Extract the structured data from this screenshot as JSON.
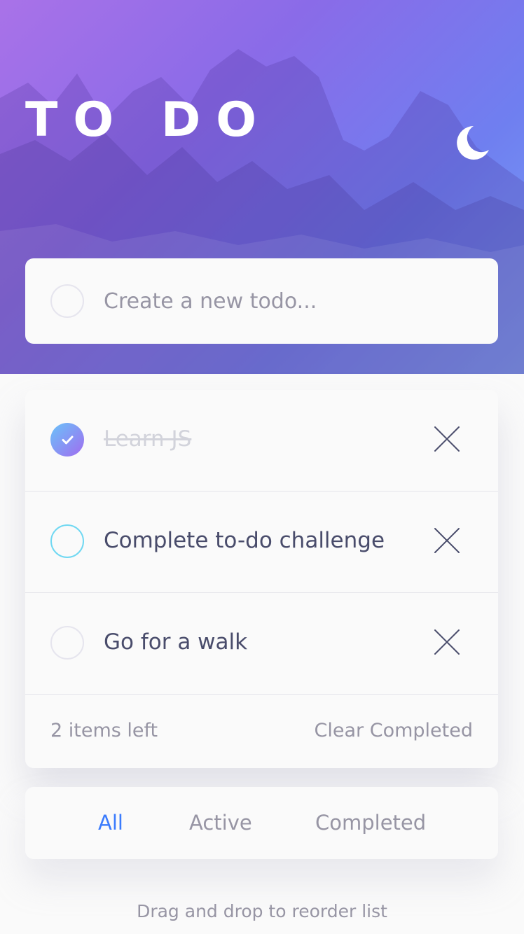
{
  "header": {
    "title": "TO DO",
    "theme_icon": "moon-icon"
  },
  "new_todo": {
    "placeholder": "Create a new todo..."
  },
  "todos": [
    {
      "text": "Learn JS",
      "completed": true
    },
    {
      "text": "Complete to-do challenge",
      "completed": false
    },
    {
      "text": "Go for a walk",
      "completed": false
    }
  ],
  "footer": {
    "items_left": "2 items left",
    "clear_label": "Clear Completed"
  },
  "filters": {
    "all": "All",
    "active": "Active",
    "completed": "Completed",
    "selected": "All"
  },
  "hint": "Drag and drop to reorder list",
  "colors": {
    "accent": "#3a7bfd",
    "check_gradient_start": "#6ac3f9",
    "check_gradient_end": "#a06cf0",
    "text_primary": "#494c6b",
    "text_muted": "#9795a4"
  }
}
